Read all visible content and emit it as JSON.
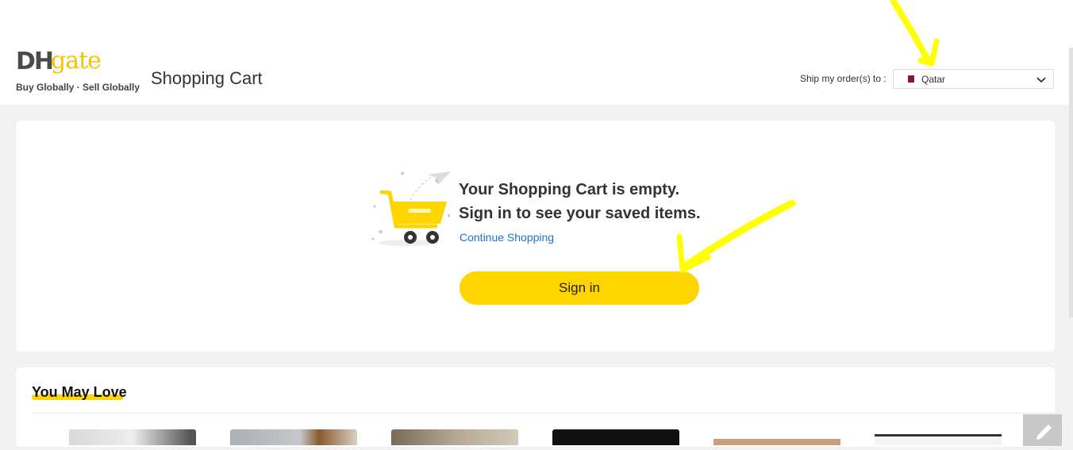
{
  "header": {
    "logo": {
      "brand_dh": "DH",
      "brand_gate": "gate",
      "tagline": "Buy Globally · Sell Globally"
    },
    "page_title": "Shopping Cart",
    "ship_to": {
      "label": "Ship my order(s) to :",
      "selected_country": "Qatar",
      "flag_icon": "qatar-flag-icon"
    }
  },
  "cart": {
    "empty_message": "Your Shopping Cart is empty.",
    "sign_in_prompt": "Sign in to see your saved items.",
    "continue_link": "Continue Shopping",
    "sign_in_button": "Sign in",
    "illustration_icon": "shopping-cart-icon"
  },
  "recommendations": {
    "title": "You May Love",
    "thumbnails": [
      "product-image",
      "product-image",
      "product-image",
      "product-image",
      "product-image",
      "product-image"
    ]
  },
  "colors": {
    "brand_yellow": "#ffd500",
    "link_blue": "#1a73c8",
    "background": "#f2f2f2"
  },
  "annotations": {
    "marker_color": "#ffff00",
    "marker_icon": "arrow-marker"
  }
}
